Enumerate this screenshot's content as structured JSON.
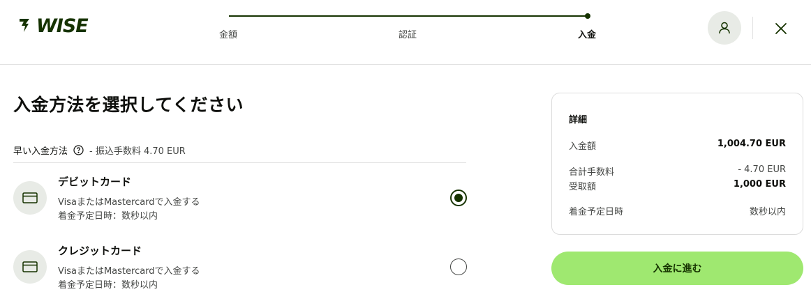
{
  "brand": {
    "name": "WISE",
    "color": "#163300",
    "accent": "#9fe870"
  },
  "stepper": {
    "steps": [
      {
        "label": "金額"
      },
      {
        "label": "認証"
      },
      {
        "label": "入金",
        "current": true
      }
    ]
  },
  "header": {
    "account_icon": "user-icon",
    "close_icon": "close-icon"
  },
  "main": {
    "title": "入金方法を選択してください",
    "fast_label": "早い入金方法",
    "fee_note": "- 振込手数料 4.70 EUR",
    "options": [
      {
        "title": "デビットカード",
        "line1": "VisaまたはMastercardで入金する",
        "line2": "着金予定日時：数秒以内",
        "icon": "card-icon",
        "selected": true
      },
      {
        "title": "クレジットカード",
        "line1": "VisaまたはMastercardで入金する",
        "line2": "着金予定日時：数秒以内",
        "icon": "card-icon",
        "selected": false
      }
    ]
  },
  "summary": {
    "title": "詳細",
    "rows": [
      {
        "label": "入金額",
        "value": "1,004.70 EUR"
      },
      {
        "label": "合計手数料",
        "value": "- 4.70 EUR"
      },
      {
        "label": "受取額",
        "value": "1,000 EUR"
      },
      {
        "label": "着金予定日時",
        "value": "数秒以内"
      }
    ],
    "button_label": "入金に進む"
  }
}
